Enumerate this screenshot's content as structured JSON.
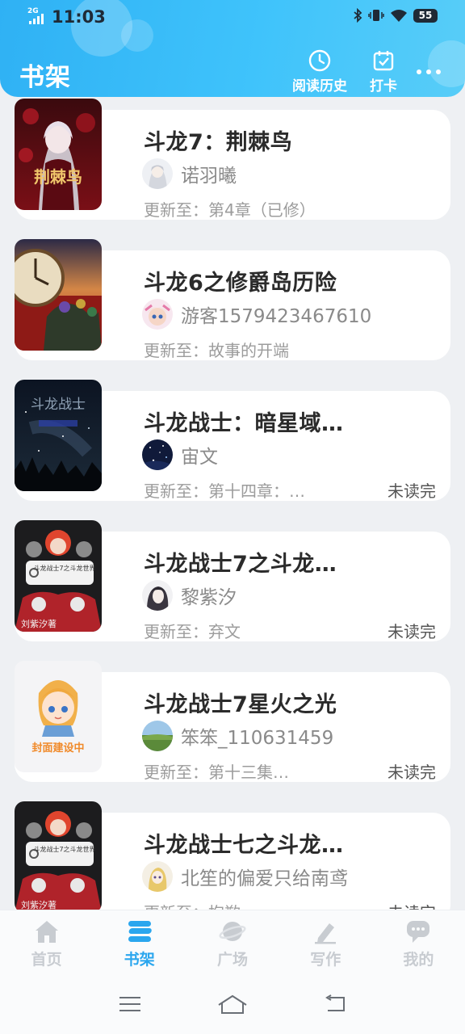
{
  "status_bar": {
    "time": "11:03",
    "network": "2G",
    "battery": "55"
  },
  "header": {
    "title": "书架",
    "history_label": "阅读历史",
    "checkin_label": "打卡"
  },
  "books": [
    {
      "title": "斗龙7：荆棘鸟",
      "author": "诺羽曦",
      "update": "更新至：第4章（已修）",
      "status": ""
    },
    {
      "title": "斗龙6之修爵岛历险",
      "author": "游客1579423467610",
      "update": "更新至：故事的开端",
      "status": ""
    },
    {
      "title": "斗龙战士：暗星域…",
      "author": "宙文",
      "update": "更新至：第十四章：…",
      "status": "未读完"
    },
    {
      "title": "斗龙战士7之斗龙…",
      "author": "黎紫汐",
      "update": "更新至：弃文",
      "status": "未读完"
    },
    {
      "title": "斗龙战士7星火之光",
      "author": "笨笨_110631459",
      "update": "更新至：第十三集…",
      "status": "未读完"
    },
    {
      "title": "斗龙战士七之斗龙…",
      "author": "北笙的偏爱只给南鸢",
      "update": "更新至：抱歉",
      "status": "未读完"
    }
  ],
  "covers": {
    "book1_text": "荆棘鸟",
    "book3_text": "斗龙战士",
    "book4_text": "斗龙战士7之斗龙世界",
    "book4_author": "刘紫汐著",
    "book5_text": "封面建设中",
    "book6_text": "斗龙战士7之斗龙世界",
    "book6_author": "刘紫汐著"
  },
  "nav": [
    {
      "label": "首页",
      "active": false
    },
    {
      "label": "书架",
      "active": true
    },
    {
      "label": "广场",
      "active": false
    },
    {
      "label": "写作",
      "active": false
    },
    {
      "label": "我的",
      "active": false
    }
  ],
  "colors": {
    "accent": "#2aa6ee",
    "header_start": "#2fb1f4",
    "header_end": "#58cdf8",
    "inactive": "#c8ccd1"
  }
}
